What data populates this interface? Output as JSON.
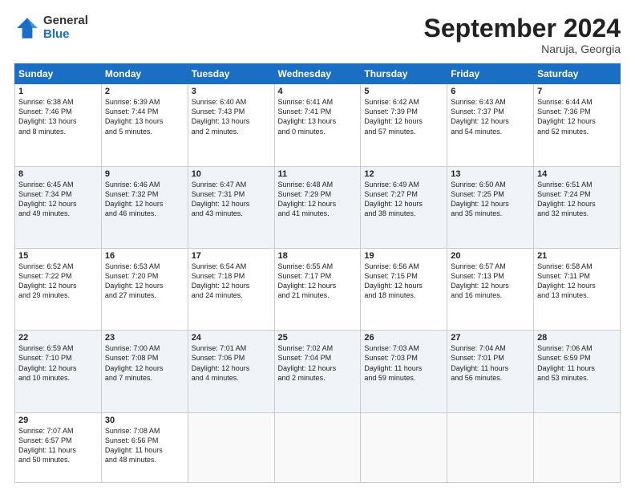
{
  "header": {
    "logo_general": "General",
    "logo_blue": "Blue",
    "month_title": "September 2024",
    "location": "Naruja, Georgia"
  },
  "weekdays": [
    "Sunday",
    "Monday",
    "Tuesday",
    "Wednesday",
    "Thursday",
    "Friday",
    "Saturday"
  ],
  "weeks": [
    [
      {
        "day": "1",
        "info": "Sunrise: 6:38 AM\nSunset: 7:46 PM\nDaylight: 13 hours\nand 8 minutes."
      },
      {
        "day": "2",
        "info": "Sunrise: 6:39 AM\nSunset: 7:44 PM\nDaylight: 13 hours\nand 5 minutes."
      },
      {
        "day": "3",
        "info": "Sunrise: 6:40 AM\nSunset: 7:43 PM\nDaylight: 13 hours\nand 2 minutes."
      },
      {
        "day": "4",
        "info": "Sunrise: 6:41 AM\nSunset: 7:41 PM\nDaylight: 13 hours\nand 0 minutes."
      },
      {
        "day": "5",
        "info": "Sunrise: 6:42 AM\nSunset: 7:39 PM\nDaylight: 12 hours\nand 57 minutes."
      },
      {
        "day": "6",
        "info": "Sunrise: 6:43 AM\nSunset: 7:37 PM\nDaylight: 12 hours\nand 54 minutes."
      },
      {
        "day": "7",
        "info": "Sunrise: 6:44 AM\nSunset: 7:36 PM\nDaylight: 12 hours\nand 52 minutes."
      }
    ],
    [
      {
        "day": "8",
        "info": "Sunrise: 6:45 AM\nSunset: 7:34 PM\nDaylight: 12 hours\nand 49 minutes."
      },
      {
        "day": "9",
        "info": "Sunrise: 6:46 AM\nSunset: 7:32 PM\nDaylight: 12 hours\nand 46 minutes."
      },
      {
        "day": "10",
        "info": "Sunrise: 6:47 AM\nSunset: 7:31 PM\nDaylight: 12 hours\nand 43 minutes."
      },
      {
        "day": "11",
        "info": "Sunrise: 6:48 AM\nSunset: 7:29 PM\nDaylight: 12 hours\nand 41 minutes."
      },
      {
        "day": "12",
        "info": "Sunrise: 6:49 AM\nSunset: 7:27 PM\nDaylight: 12 hours\nand 38 minutes."
      },
      {
        "day": "13",
        "info": "Sunrise: 6:50 AM\nSunset: 7:25 PM\nDaylight: 12 hours\nand 35 minutes."
      },
      {
        "day": "14",
        "info": "Sunrise: 6:51 AM\nSunset: 7:24 PM\nDaylight: 12 hours\nand 32 minutes."
      }
    ],
    [
      {
        "day": "15",
        "info": "Sunrise: 6:52 AM\nSunset: 7:22 PM\nDaylight: 12 hours\nand 29 minutes."
      },
      {
        "day": "16",
        "info": "Sunrise: 6:53 AM\nSunset: 7:20 PM\nDaylight: 12 hours\nand 27 minutes."
      },
      {
        "day": "17",
        "info": "Sunrise: 6:54 AM\nSunset: 7:18 PM\nDaylight: 12 hours\nand 24 minutes."
      },
      {
        "day": "18",
        "info": "Sunrise: 6:55 AM\nSunset: 7:17 PM\nDaylight: 12 hours\nand 21 minutes."
      },
      {
        "day": "19",
        "info": "Sunrise: 6:56 AM\nSunset: 7:15 PM\nDaylight: 12 hours\nand 18 minutes."
      },
      {
        "day": "20",
        "info": "Sunrise: 6:57 AM\nSunset: 7:13 PM\nDaylight: 12 hours\nand 16 minutes."
      },
      {
        "day": "21",
        "info": "Sunrise: 6:58 AM\nSunset: 7:11 PM\nDaylight: 12 hours\nand 13 minutes."
      }
    ],
    [
      {
        "day": "22",
        "info": "Sunrise: 6:59 AM\nSunset: 7:10 PM\nDaylight: 12 hours\nand 10 minutes."
      },
      {
        "day": "23",
        "info": "Sunrise: 7:00 AM\nSunset: 7:08 PM\nDaylight: 12 hours\nand 7 minutes."
      },
      {
        "day": "24",
        "info": "Sunrise: 7:01 AM\nSunset: 7:06 PM\nDaylight: 12 hours\nand 4 minutes."
      },
      {
        "day": "25",
        "info": "Sunrise: 7:02 AM\nSunset: 7:04 PM\nDaylight: 12 hours\nand 2 minutes."
      },
      {
        "day": "26",
        "info": "Sunrise: 7:03 AM\nSunset: 7:03 PM\nDaylight: 11 hours\nand 59 minutes."
      },
      {
        "day": "27",
        "info": "Sunrise: 7:04 AM\nSunset: 7:01 PM\nDaylight: 11 hours\nand 56 minutes."
      },
      {
        "day": "28",
        "info": "Sunrise: 7:06 AM\nSunset: 6:59 PM\nDaylight: 11 hours\nand 53 minutes."
      }
    ],
    [
      {
        "day": "29",
        "info": "Sunrise: 7:07 AM\nSunset: 6:57 PM\nDaylight: 11 hours\nand 50 minutes."
      },
      {
        "day": "30",
        "info": "Sunrise: 7:08 AM\nSunset: 6:56 PM\nDaylight: 11 hours\nand 48 minutes."
      },
      {
        "day": "",
        "info": ""
      },
      {
        "day": "",
        "info": ""
      },
      {
        "day": "",
        "info": ""
      },
      {
        "day": "",
        "info": ""
      },
      {
        "day": "",
        "info": ""
      }
    ]
  ]
}
